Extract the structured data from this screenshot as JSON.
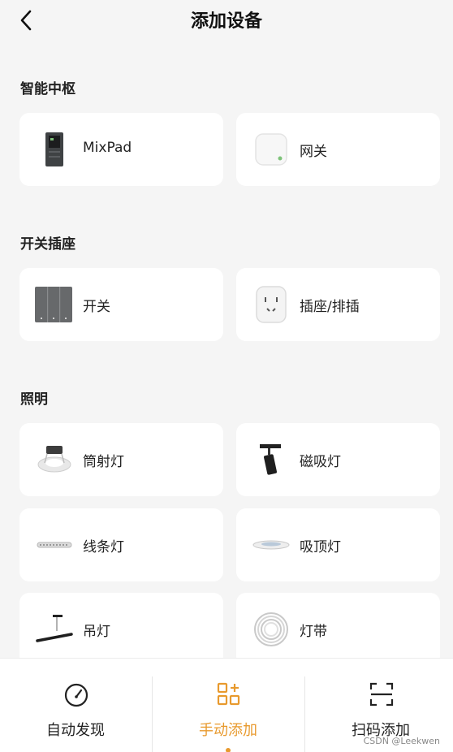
{
  "header": {
    "title": "添加设备"
  },
  "sections": [
    {
      "title": "智能中枢",
      "items": [
        {
          "label": "MixPad",
          "icon": "mixpad-panel-icon"
        },
        {
          "label": "网关",
          "icon": "gateway-hub-icon"
        }
      ]
    },
    {
      "title": "开关插座",
      "items": [
        {
          "label": "开关",
          "icon": "wall-switch-icon"
        },
        {
          "label": "插座/排插",
          "icon": "socket-icon"
        }
      ]
    },
    {
      "title": "照明",
      "items": [
        {
          "label": "筒射灯",
          "icon": "downlight-icon"
        },
        {
          "label": "磁吸灯",
          "icon": "magnetic-spotlight-icon"
        },
        {
          "label": "线条灯",
          "icon": "linear-light-icon"
        },
        {
          "label": "吸顶灯",
          "icon": "ceiling-light-icon"
        },
        {
          "label": "吊灯",
          "icon": "pendant-light-icon"
        },
        {
          "label": "灯带",
          "icon": "light-strip-icon"
        }
      ]
    }
  ],
  "tabs": [
    {
      "label": "自动发现",
      "icon": "gauge-icon",
      "active": false
    },
    {
      "label": "手动添加",
      "icon": "grid-plus-icon",
      "active": true
    },
    {
      "label": "扫码添加",
      "icon": "scan-frame-icon",
      "active": false
    }
  ],
  "watermark": "CSDN @Leekwen",
  "colors": {
    "accent": "#e89a2e",
    "background": "#f5f5f5",
    "card": "#ffffff"
  }
}
